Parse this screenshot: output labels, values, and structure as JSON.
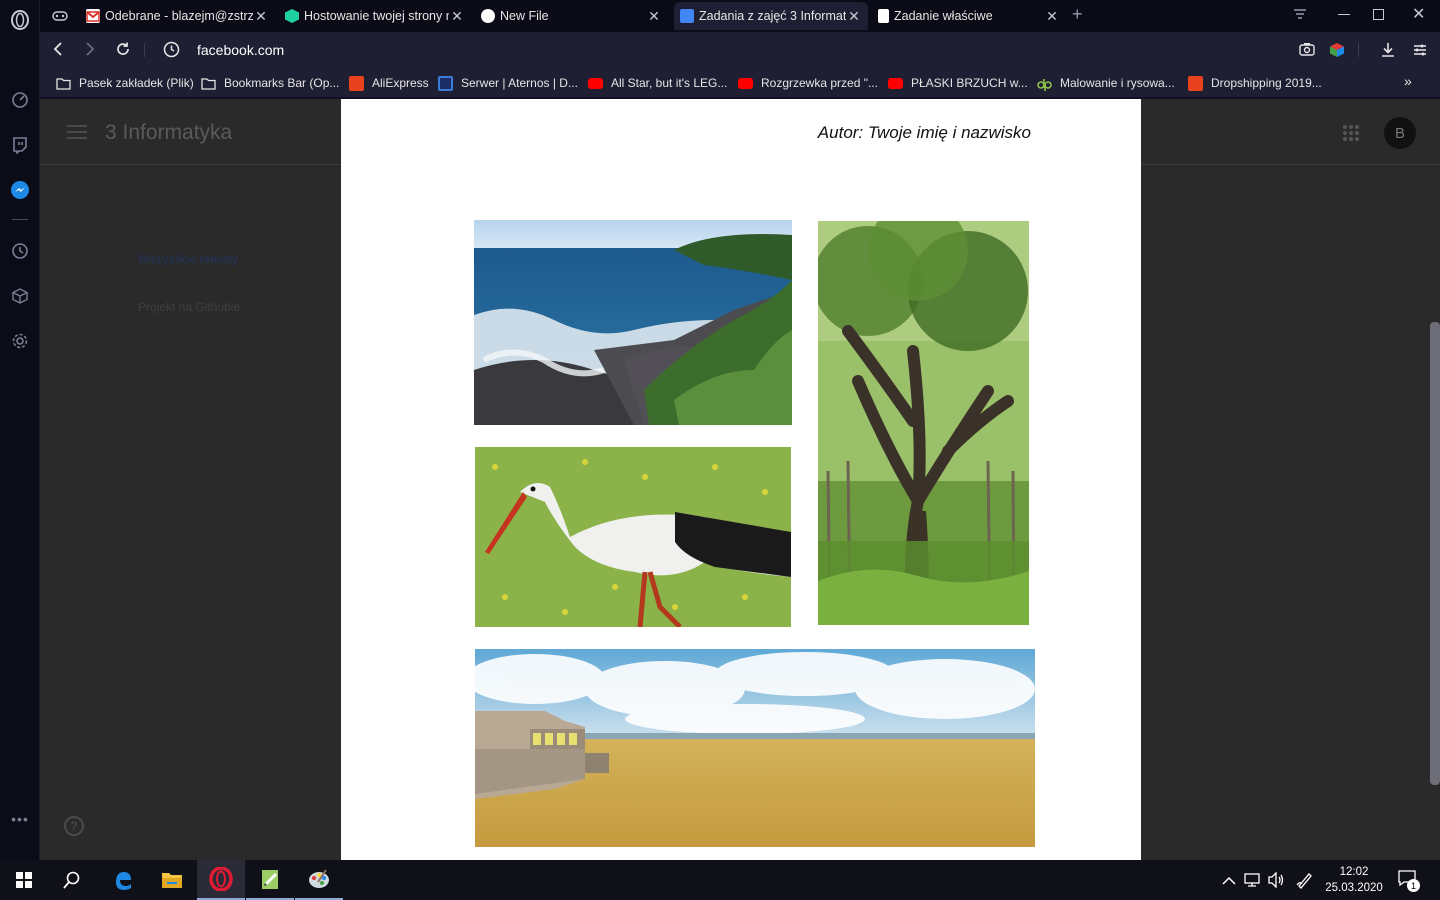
{
  "tabs": [
    {
      "label": "Odebrane - blazejm@zstrzew",
      "color": "#d93025",
      "active": false
    },
    {
      "label": "Hostowanie twojej strony na",
      "color": "#1ccf9c",
      "active": false
    },
    {
      "label": "New File",
      "color": "#ffffff",
      "active": false
    },
    {
      "label": "Zadania z zajęć 3 Informatyk",
      "color": "#4285f4",
      "active": true
    },
    {
      "label": "Zadanie właściwe",
      "color": "#ffffff",
      "active": false
    }
  ],
  "address": {
    "url": "facebook.com"
  },
  "bookmarks": [
    {
      "label": "Pasek zakładek (Plik)",
      "icon": "folder-icon",
      "color": "#ffffff"
    },
    {
      "label": "Bookmarks Bar (Op...",
      "icon": "folder-icon",
      "color": "#ffffff"
    },
    {
      "label": "AliExpress",
      "icon": "aliexpress-icon",
      "color": "#e8431e"
    },
    {
      "label": "Serwer | Aternos | D...",
      "icon": "aternos-icon",
      "color": "#3a7bd5"
    },
    {
      "label": "All Star, but it's LEG...",
      "icon": "youtube-icon",
      "color": "#ff0000"
    },
    {
      "label": "Rozgrzewka przed \"...",
      "icon": "youtube-icon",
      "color": "#ff0000"
    },
    {
      "label": "PŁASKI BRZUCH w...",
      "icon": "youtube-icon",
      "color": "#ff0000"
    },
    {
      "label": "Malowanie i rysowa...",
      "icon": "dp-icon",
      "color": "#8bc34a"
    },
    {
      "label": "Dropshipping 2019...",
      "icon": "aliexpress-icon",
      "color": "#e8431e"
    }
  ],
  "classroom": {
    "title": "3 Informatyka",
    "avatar": "B",
    "topics_all": "Wszystkie tematy",
    "topic_1": "Projekt na Githubie"
  },
  "document": {
    "author": "Autor: Twoje imię i nazwisko"
  },
  "taskbar": {
    "time": "12:02",
    "date": "25.03.2020",
    "notifications": "1"
  },
  "colors": {
    "accent_tab": "#1f1f33",
    "opera_red": "#e21b32"
  }
}
